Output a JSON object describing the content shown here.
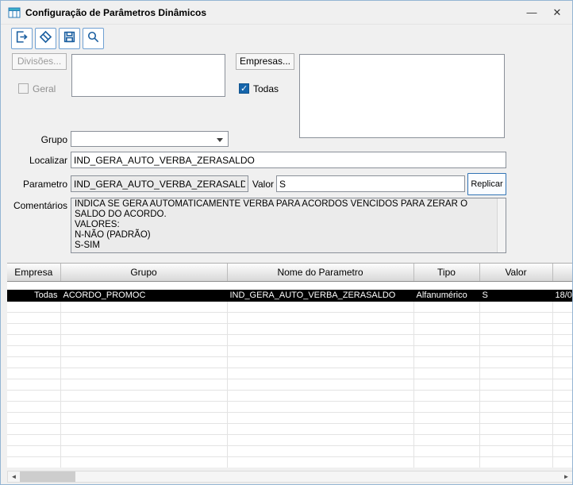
{
  "window": {
    "title": "Configuração de Parâmetros Dinâmicos",
    "minimize_glyph": "—",
    "close_glyph": "✕"
  },
  "toolbar": {
    "icons": [
      "exit-icon",
      "eraser-icon",
      "save-icon",
      "search-icon"
    ]
  },
  "form": {
    "divisoes_button": "Divisões...",
    "geral_label": "Geral",
    "geral_checked": false,
    "empresas_button": "Empresas...",
    "todas_label": "Todas",
    "todas_checked": true,
    "grupo_label": "Grupo",
    "grupo_value": "",
    "localizar_label": "Localizar",
    "localizar_value": "IND_GERA_AUTO_VERBA_ZERASALDO",
    "parametro_label": "Parametro",
    "parametro_value": "IND_GERA_AUTO_VERBA_ZERASALDO",
    "valor_label": "Valor",
    "valor_value": "S",
    "replicar_button": "Replicar",
    "comentarios_label": "Comentários",
    "comentarios_value": "INDICA SE GERA AUTOMATICAMENTE VERBA PARA ACORDOS VENCIDOS PARA ZERAR O SALDO DO ACORDO.\nVALORES:\nN-NÃO (PADRÃO)\nS-SIM"
  },
  "table": {
    "columns": [
      "Empresa",
      "Grupo",
      "Nome do Parametro",
      "Tipo",
      "Valor",
      ""
    ],
    "rows": [
      [
        "Todas",
        "ACORDO_PROMOC",
        "IND_GERA_AUTO_VERBA_ZERASALDO",
        "Alfanumérico",
        "S",
        "18/0"
      ]
    ],
    "empty_rows_above": 1,
    "empty_rows_below": 15
  },
  "scrollbar": {
    "left_glyph": "◄",
    "right_glyph": "►"
  },
  "colors": {
    "accent_blue": "#1b5fa0",
    "selected_row_bg": "#000000",
    "selected_row_fg": "#ffffff",
    "readonly_bg": "#ebebeb"
  }
}
